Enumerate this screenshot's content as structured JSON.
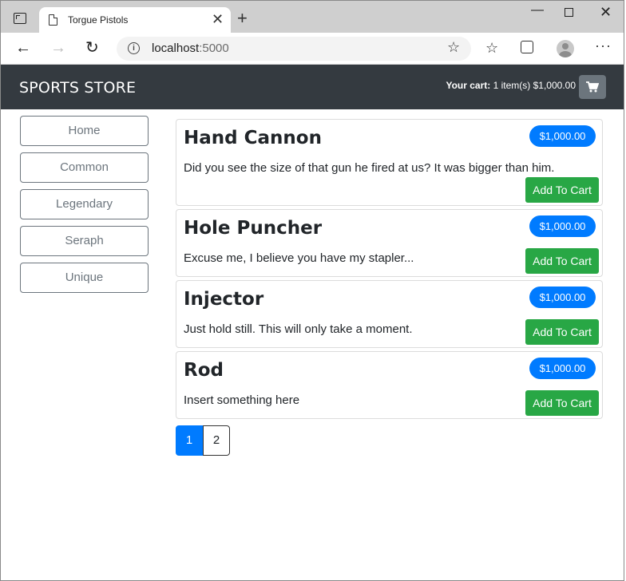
{
  "browser": {
    "tab_title": "Torgue Pistols",
    "tab_close": "✕",
    "new_tab": "+",
    "url_host": "localhost",
    "url_port": ":5000"
  },
  "navbar": {
    "brand": "SPORTS STORE",
    "cart_label": "Your cart:",
    "cart_details": "1 item(s) $1,000.00"
  },
  "categories": [
    "Home",
    "Common",
    "Legendary",
    "Seraph",
    "Unique"
  ],
  "products": [
    {
      "name": "Hand Cannon",
      "price": "$1,000.00",
      "description": "Did you see the size of that gun he fired at us? It was bigger than him.",
      "button": "Add To Cart"
    },
    {
      "name": "Hole Puncher",
      "price": "$1,000.00",
      "description": "Excuse me, I believe you have my stapler...",
      "button": "Add To Cart"
    },
    {
      "name": "Injector",
      "price": "$1,000.00",
      "description": "Just hold still. This will only take a moment.",
      "button": "Add To Cart"
    },
    {
      "name": "Rod",
      "price": "$1,000.00",
      "description": "Insert something here",
      "button": "Add To Cart"
    }
  ],
  "pagination": [
    "1",
    "2"
  ],
  "colors": {
    "navbar": "#343a40",
    "primary": "#007bff",
    "success": "#28a745",
    "secondary": "#6c757d"
  },
  "icons": {
    "back": "arrow-left-icon",
    "forward": "arrow-right-icon",
    "reload": "reload-icon",
    "cart": "shopping-cart-icon"
  }
}
